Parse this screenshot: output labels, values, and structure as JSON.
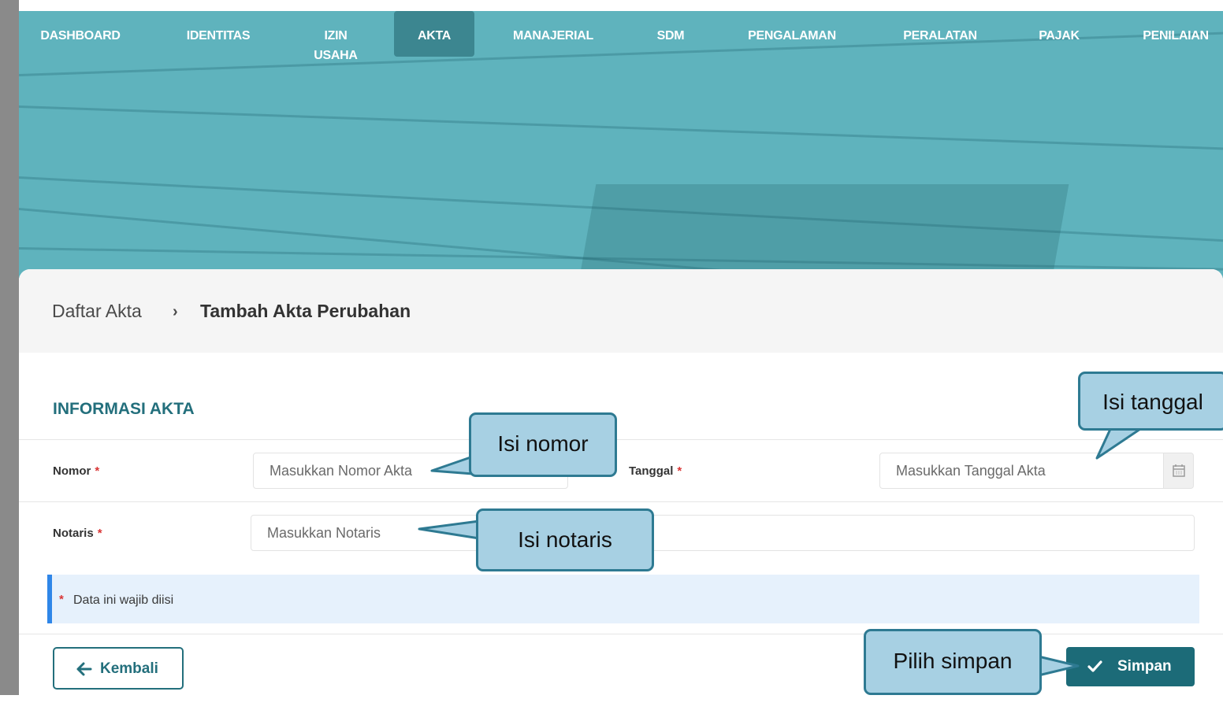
{
  "nav": {
    "items": [
      {
        "label": "DASHBOARD"
      },
      {
        "label": "IDENTITAS"
      },
      {
        "label": "IZIN\nUSAHA"
      },
      {
        "label": "AKTA"
      },
      {
        "label": "MANAJERIAL"
      },
      {
        "label": "SDM"
      },
      {
        "label": "PENGALAMAN"
      },
      {
        "label": "PERALATAN"
      },
      {
        "label": "PAJAK"
      },
      {
        "label": "PENILAIAN"
      }
    ],
    "active_index": 3
  },
  "breadcrumb": {
    "parent": "Daftar Akta",
    "separator": "›",
    "current": "Tambah Akta Perubahan"
  },
  "section": {
    "title": "INFORMASI AKTA"
  },
  "form": {
    "nomor": {
      "label": "Nomor",
      "required_mark": "*",
      "placeholder": "Masukkan Nomor Akta",
      "value": ""
    },
    "tanggal": {
      "label": "Tanggal",
      "required_mark": "*",
      "placeholder": "Masukkan Tanggal Akta",
      "value": "",
      "icon": "calendar-icon"
    },
    "notaris": {
      "label": "Notaris",
      "required_mark": "*",
      "placeholder": "Masukkan Notaris",
      "value": ""
    }
  },
  "notice": {
    "star": "*",
    "text": "Data ini wajib diisi"
  },
  "buttons": {
    "back": {
      "label": "Kembali",
      "icon": "arrow-left-icon"
    },
    "save": {
      "label": "Simpan",
      "icon": "check-icon"
    }
  },
  "callouts": {
    "nomor": "Isi nomor",
    "tanggal": "Isi tanggal",
    "notaris": "Isi notaris",
    "simpan": "Pilih simpan"
  },
  "colors": {
    "hero": "#5fb3bd",
    "primary": "#236f7c",
    "save_button": "#1c6b78",
    "notice_bg": "#e6f1fc",
    "notice_border": "#2f86e8",
    "required": "#d93636",
    "callout_fill": "#a7d0e3",
    "callout_border": "#2e7a92"
  }
}
